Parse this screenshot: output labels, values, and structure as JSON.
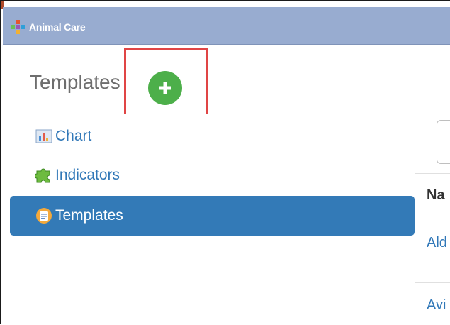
{
  "window": {
    "title": "Animal Care"
  },
  "header": {
    "page_title": "Templates",
    "add_button_symbol": "+"
  },
  "sidebar": {
    "items": [
      {
        "label": "Chart",
        "icon": "chart-icon",
        "active": false
      },
      {
        "label": "Indicators",
        "icon": "puzzle-icon",
        "active": false
      },
      {
        "label": "Templates",
        "icon": "templates-icon",
        "active": true
      }
    ]
  },
  "table": {
    "column_header": "Na",
    "rows": [
      "Ald",
      "Avi"
    ]
  },
  "colors": {
    "titlebar": "#98acd0",
    "add_button": "#4daf4a",
    "active_item": "#337ab7",
    "link": "#3178b8",
    "highlight": "#e04545"
  }
}
